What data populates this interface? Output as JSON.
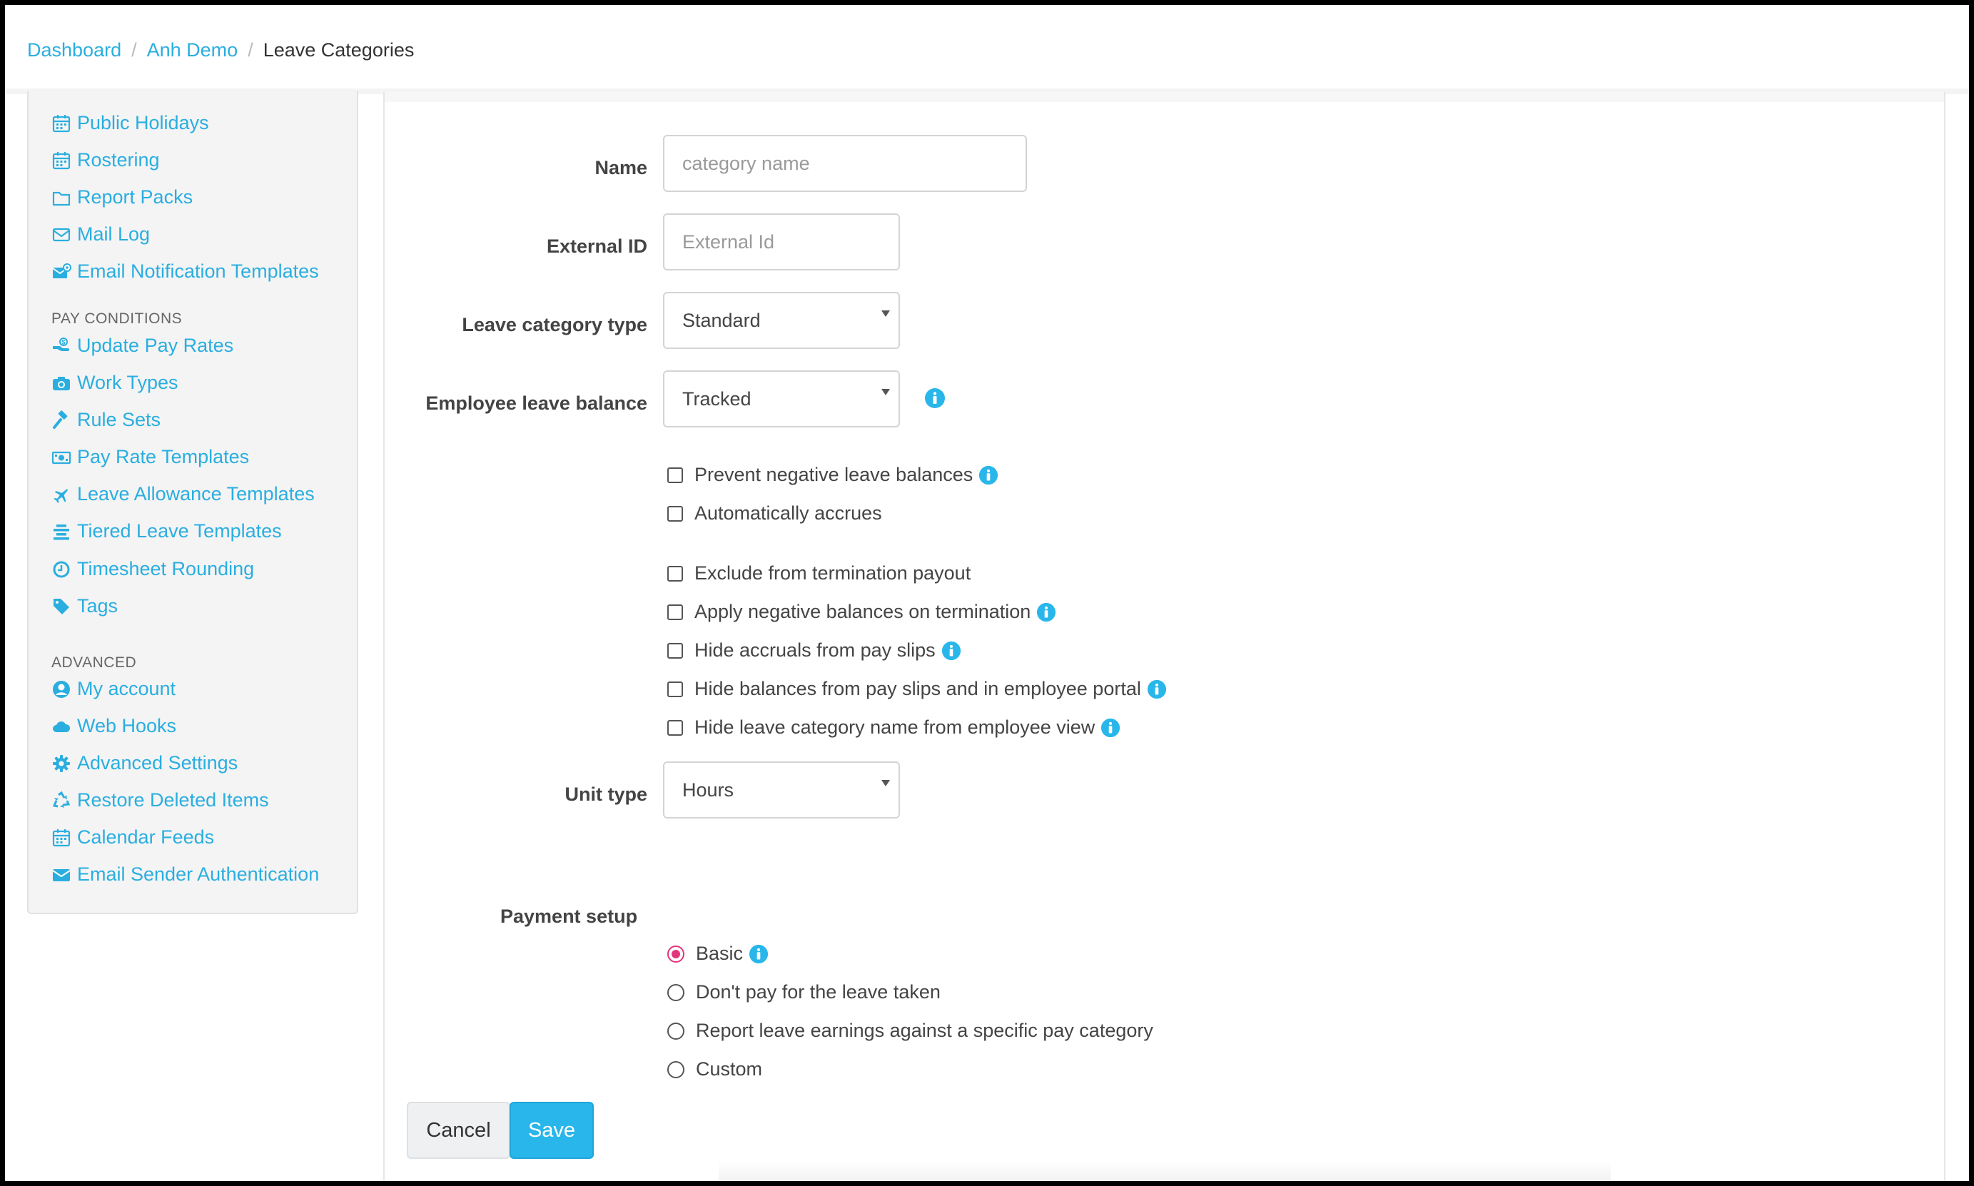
{
  "breadcrumb": {
    "items": [
      "Dashboard",
      "Anh Demo",
      "Leave Categories"
    ],
    "separator": "/"
  },
  "sidebar": {
    "group1": [
      {
        "label": "Public Holidays",
        "icon": "calendar-icon"
      },
      {
        "label": "Rostering",
        "icon": "calendar-icon"
      },
      {
        "label": "Report Packs",
        "icon": "folder-icon"
      },
      {
        "label": "Mail Log",
        "icon": "envelope-outline-icon"
      },
      {
        "label": "Email Notification Templates",
        "icon": "envelope-gear-icon"
      }
    ],
    "pay_conditions_heading": "PAY CONDITIONS",
    "pay_conditions": [
      {
        "label": "Update Pay Rates",
        "icon": "hand-money-icon"
      },
      {
        "label": "Work Types",
        "icon": "camera-icon"
      },
      {
        "label": "Rule Sets",
        "icon": "gavel-icon"
      },
      {
        "label": "Pay Rate Templates",
        "icon": "money-bill-icon"
      },
      {
        "label": "Leave Allowance Templates",
        "icon": "plane-icon"
      },
      {
        "label": "Tiered Leave Templates",
        "icon": "tiers-icon"
      },
      {
        "label": "Timesheet Rounding",
        "icon": "clock-icon"
      },
      {
        "label": "Tags",
        "icon": "tag-icon"
      }
    ],
    "advanced_heading": "ADVANCED",
    "advanced": [
      {
        "label": "My account",
        "icon": "user-circle-icon"
      },
      {
        "label": "Web Hooks",
        "icon": "cloud-icon"
      },
      {
        "label": "Advanced Settings",
        "icon": "gear-icon"
      },
      {
        "label": "Restore Deleted Items",
        "icon": "recycle-icon"
      },
      {
        "label": "Calendar Feeds",
        "icon": "calendar-icon"
      },
      {
        "label": "Email Sender Authentication",
        "icon": "envelope-icon"
      }
    ]
  },
  "form": {
    "name": {
      "label": "Name",
      "value": "",
      "placeholder": "category name"
    },
    "external_id": {
      "label": "External ID",
      "value": "",
      "placeholder": "External Id"
    },
    "leave_category_type": {
      "label": "Leave category type",
      "selected": "Standard"
    },
    "employee_leave_balance": {
      "label": "Employee leave balance",
      "selected": "Tracked"
    },
    "checkboxes": [
      {
        "label": "Prevent negative leave balances",
        "checked": false,
        "info": true
      },
      {
        "label": "Automatically accrues",
        "checked": false,
        "info": false
      },
      {
        "label": "Exclude from termination payout",
        "checked": false,
        "info": false
      },
      {
        "label": "Apply negative balances on termination",
        "checked": false,
        "info": true
      },
      {
        "label": "Hide accruals from pay slips",
        "checked": false,
        "info": true
      },
      {
        "label": "Hide balances from pay slips and in employee portal",
        "checked": false,
        "info": true
      },
      {
        "label": "Hide leave category name from employee view",
        "checked": false,
        "info": true
      }
    ],
    "unit_type": {
      "label": "Unit type",
      "selected": "Hours"
    },
    "payment_setup": {
      "label": "Payment setup",
      "options": [
        {
          "label": "Basic",
          "checked": true,
          "info": true
        },
        {
          "label": "Don't pay for the leave taken",
          "checked": false,
          "info": false
        },
        {
          "label": "Report leave earnings against a specific pay category",
          "checked": false,
          "info": false
        },
        {
          "label": "Custom",
          "checked": false,
          "info": false
        }
      ]
    }
  },
  "actions": {
    "cancel_label": "Cancel",
    "save_label": "Save"
  },
  "colors": {
    "link": "#2aaee0",
    "primary": "#29b6ea",
    "radio_checked": "#e2357d",
    "info": "#29b6ea"
  }
}
